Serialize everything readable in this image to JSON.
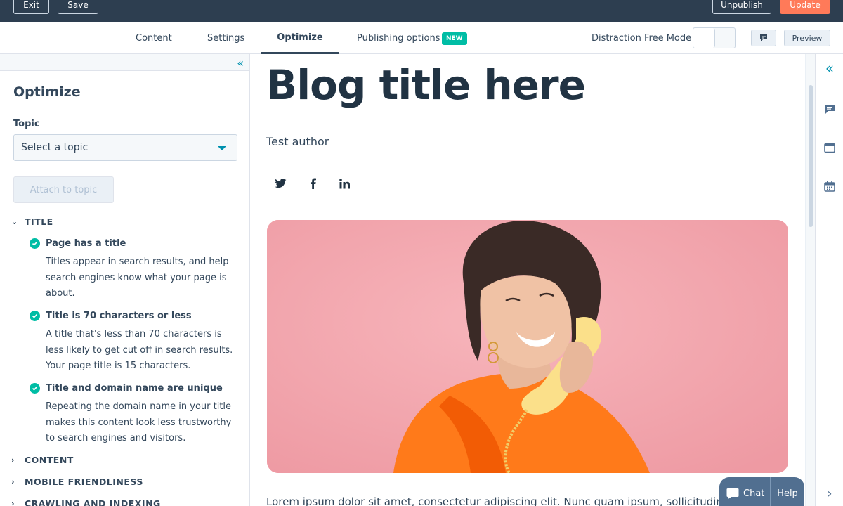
{
  "topbar": {
    "exit_label": "Exit",
    "save_label": "Save",
    "unpublish_label": "Unpublish",
    "update_label": "Update"
  },
  "tabs": {
    "content": "Content",
    "settings": "Settings",
    "optimize": "Optimize",
    "publishing": "Publishing options",
    "new_badge": "NEW",
    "distraction_free": "Distraction Free Mode",
    "preview": "Preview"
  },
  "sidebar": {
    "heading": "Optimize",
    "topic_label": "Topic",
    "topic_value": "Select a topic",
    "attach_label": "Attach to topic",
    "sections": [
      {
        "label": "TITLE",
        "expanded": true
      },
      {
        "label": "CONTENT",
        "expanded": false
      },
      {
        "label": "MOBILE FRIENDLINESS",
        "expanded": false
      },
      {
        "label": "CRAWLING AND INDEXING",
        "expanded": false
      }
    ],
    "checks": [
      {
        "title": "Page has a title",
        "desc": "Titles appear in search results, and help search engines know what your page is about."
      },
      {
        "title": "Title is 70 characters or less",
        "desc": "A title that's less than 70 characters is less likely to get cut off in search results. Your page title is 15 characters."
      },
      {
        "title": "Title and domain name are unique",
        "desc": "Repeating the domain name in your title makes this content look less trustworthy to search engines and visitors."
      }
    ]
  },
  "editor": {
    "blog_title": "Blog title here",
    "author": "Test author",
    "body_text": "Lorem ipsum dolor sit amet, consectetur adipiscing elit. Nunc quam ipsum, sollicitudin vi"
  },
  "chat": {
    "chat_label": "Chat",
    "help_label": "Help"
  },
  "colors": {
    "topbar_bg": "#2d3e50",
    "accent_orange": "#ff7a59",
    "success_teal": "#00bda5",
    "title_navy": "#213343"
  }
}
